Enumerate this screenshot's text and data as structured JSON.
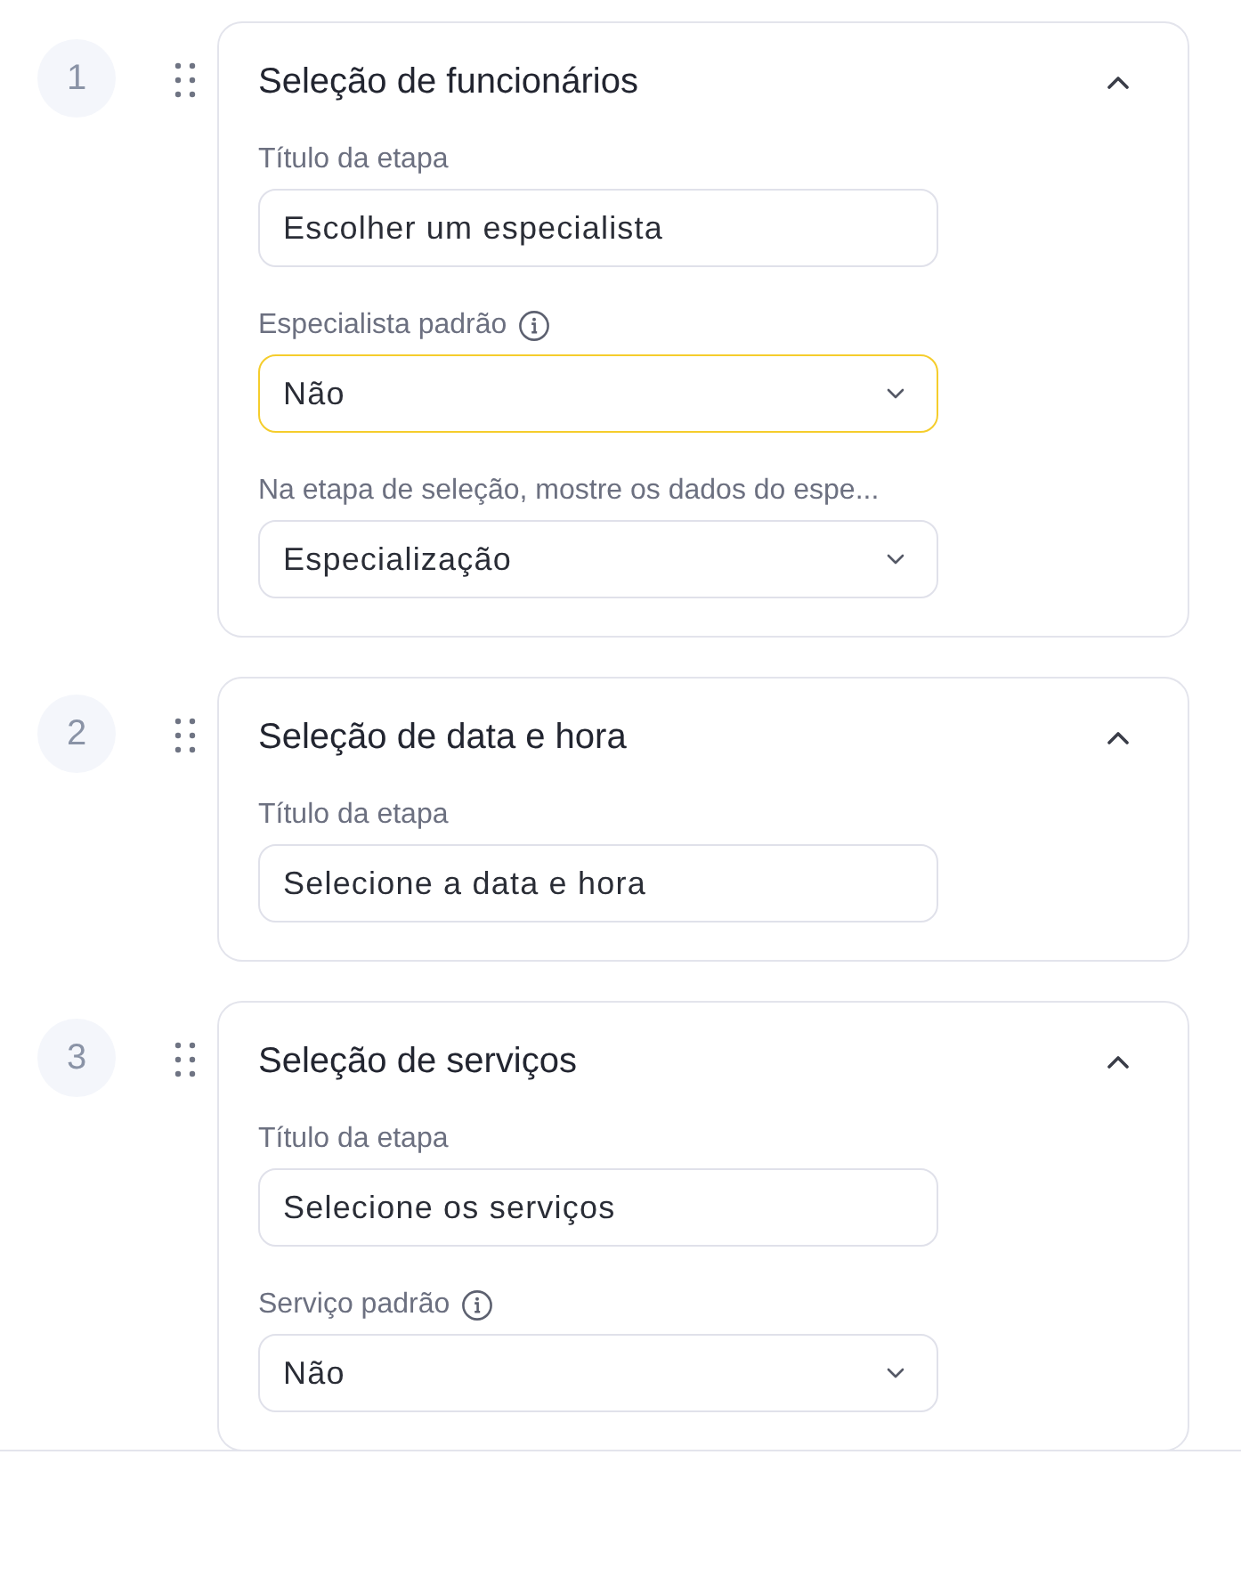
{
  "steps": [
    {
      "number": "1",
      "title": "Seleção de funcionários",
      "expanded": true,
      "fields": [
        {
          "kind": "text",
          "label": "Título da etapa",
          "info": false,
          "value": "Escolher um especialista",
          "focused": false
        },
        {
          "kind": "select",
          "label": "Especialista padrão",
          "info": true,
          "value": "Não",
          "focused": true
        },
        {
          "kind": "select",
          "label": "Na etapa de seleção, mostre os dados do espe...",
          "info": false,
          "value": "Especialização",
          "focused": false
        }
      ]
    },
    {
      "number": "2",
      "title": "Seleção de data e hora",
      "expanded": true,
      "fields": [
        {
          "kind": "text",
          "label": "Título da etapa",
          "info": false,
          "value": "Selecione a data e hora",
          "focused": false
        }
      ]
    },
    {
      "number": "3",
      "title": "Seleção de serviços",
      "expanded": true,
      "fields": [
        {
          "kind": "text",
          "label": "Título da etapa",
          "info": false,
          "value": "Selecione os serviços",
          "focused": false
        },
        {
          "kind": "select",
          "label": "Serviço padrão",
          "info": true,
          "value": "Não",
          "focused": false
        }
      ]
    }
  ]
}
